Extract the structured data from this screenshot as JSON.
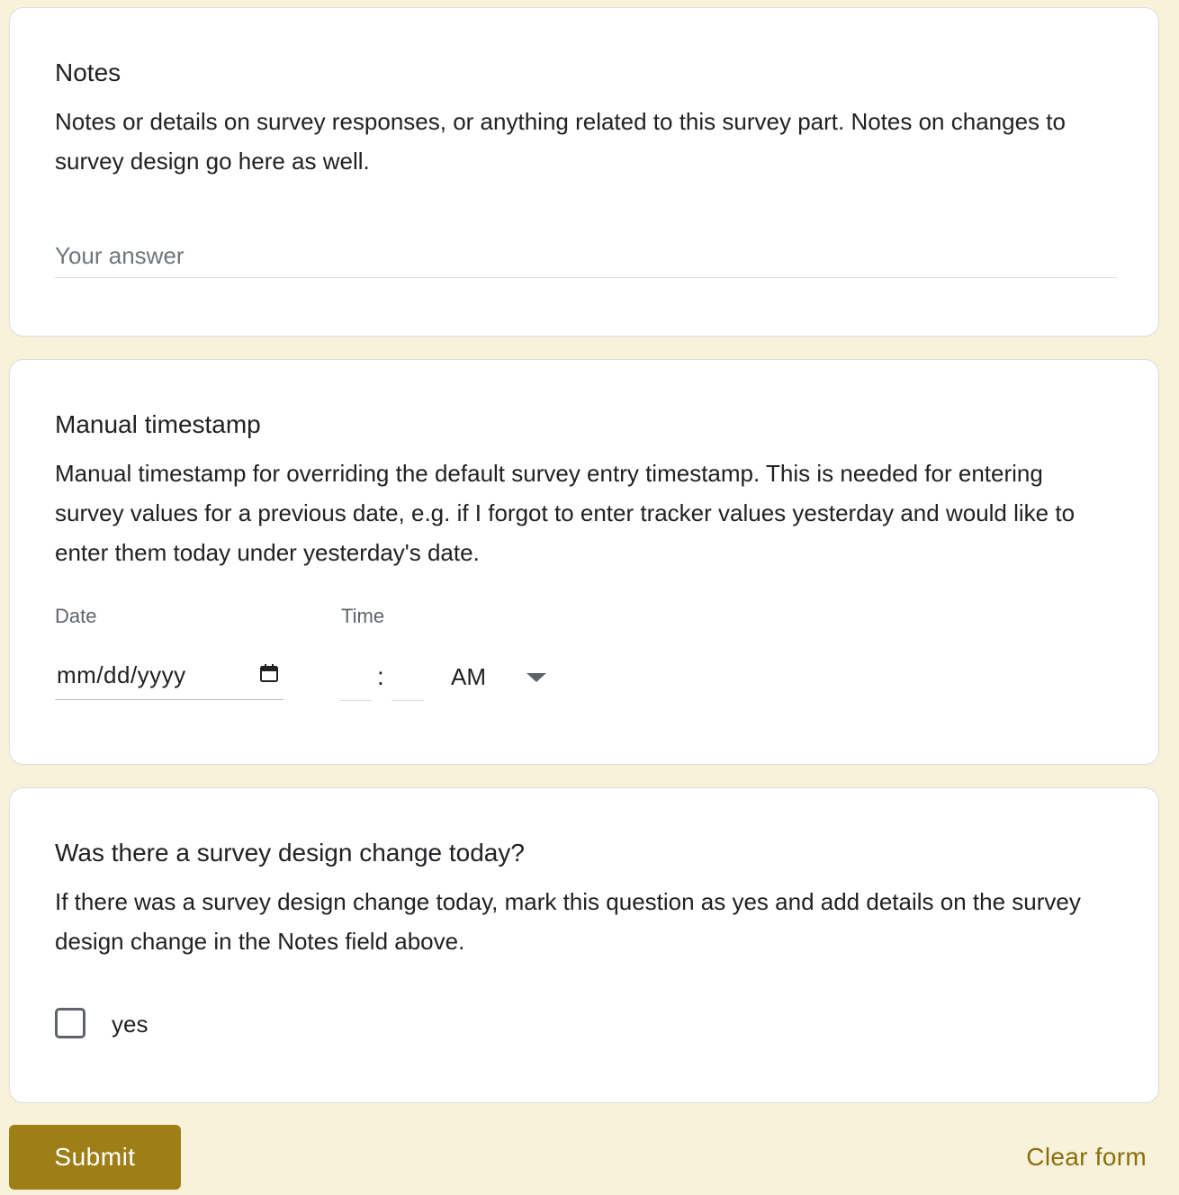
{
  "notes": {
    "title": "Notes",
    "description": "Notes or details on survey responses, or anything related to this survey part. Notes on changes to survey design go here as well.",
    "placeholder": "Your answer",
    "value": ""
  },
  "timestamp": {
    "title": "Manual timestamp",
    "description": "Manual timestamp for overriding the default survey entry timestamp. This is needed for entering survey values for a previous date, e.g. if I forgot to enter tracker values yesterday and would like to enter them today under yesterday's date.",
    "date_label": "Date",
    "time_label": "Time",
    "date_placeholder": "mm/dd/yyyy",
    "time_separator": ":",
    "ampm_value": "AM"
  },
  "design_change": {
    "title": "Was there a survey design change today?",
    "description": "If there was a survey design change today, mark this question as yes and add details on the survey design change in the Notes field above.",
    "option_label": "yes",
    "checked": false
  },
  "footer": {
    "submit_label": "Submit",
    "clear_label": "Clear form"
  },
  "colors": {
    "page_background": "#f8f2da",
    "accent": "#9e7f17",
    "accent_text": "#8a6f0f"
  },
  "icons": {
    "date_picker": "calendar-icon",
    "ampm_dropdown": "caret-down-icon"
  }
}
